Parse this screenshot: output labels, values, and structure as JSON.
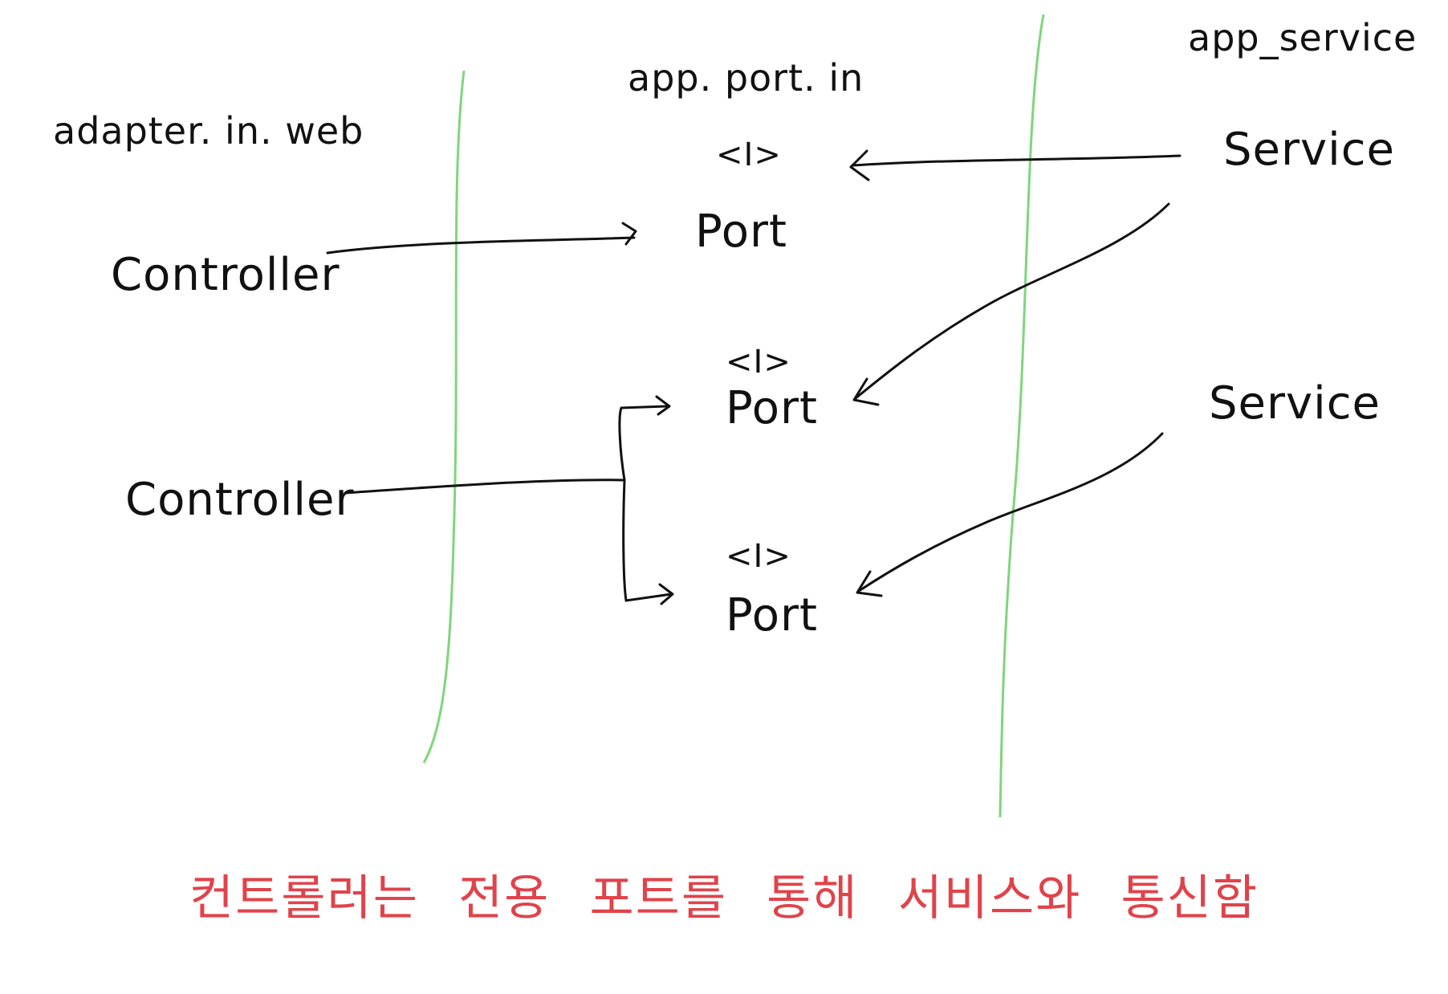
{
  "packages": {
    "adapter": "adapter. in. web",
    "port": "app. port. in",
    "service": "app_service"
  },
  "controllers": [
    "Controller",
    "Controller"
  ],
  "ports": [
    {
      "stereotype": "<I>",
      "label": "Port"
    },
    {
      "stereotype": "<I>",
      "label": "Port"
    },
    {
      "stereotype": "<I>",
      "label": "Port"
    }
  ],
  "services": [
    "Service",
    "Service"
  ],
  "caption": "컨트롤러는 전용 포트를 통해 서비스와 통신함",
  "colors": {
    "ink": "#111111",
    "boundary": "#7ed67a",
    "caption": "#e0434a"
  }
}
